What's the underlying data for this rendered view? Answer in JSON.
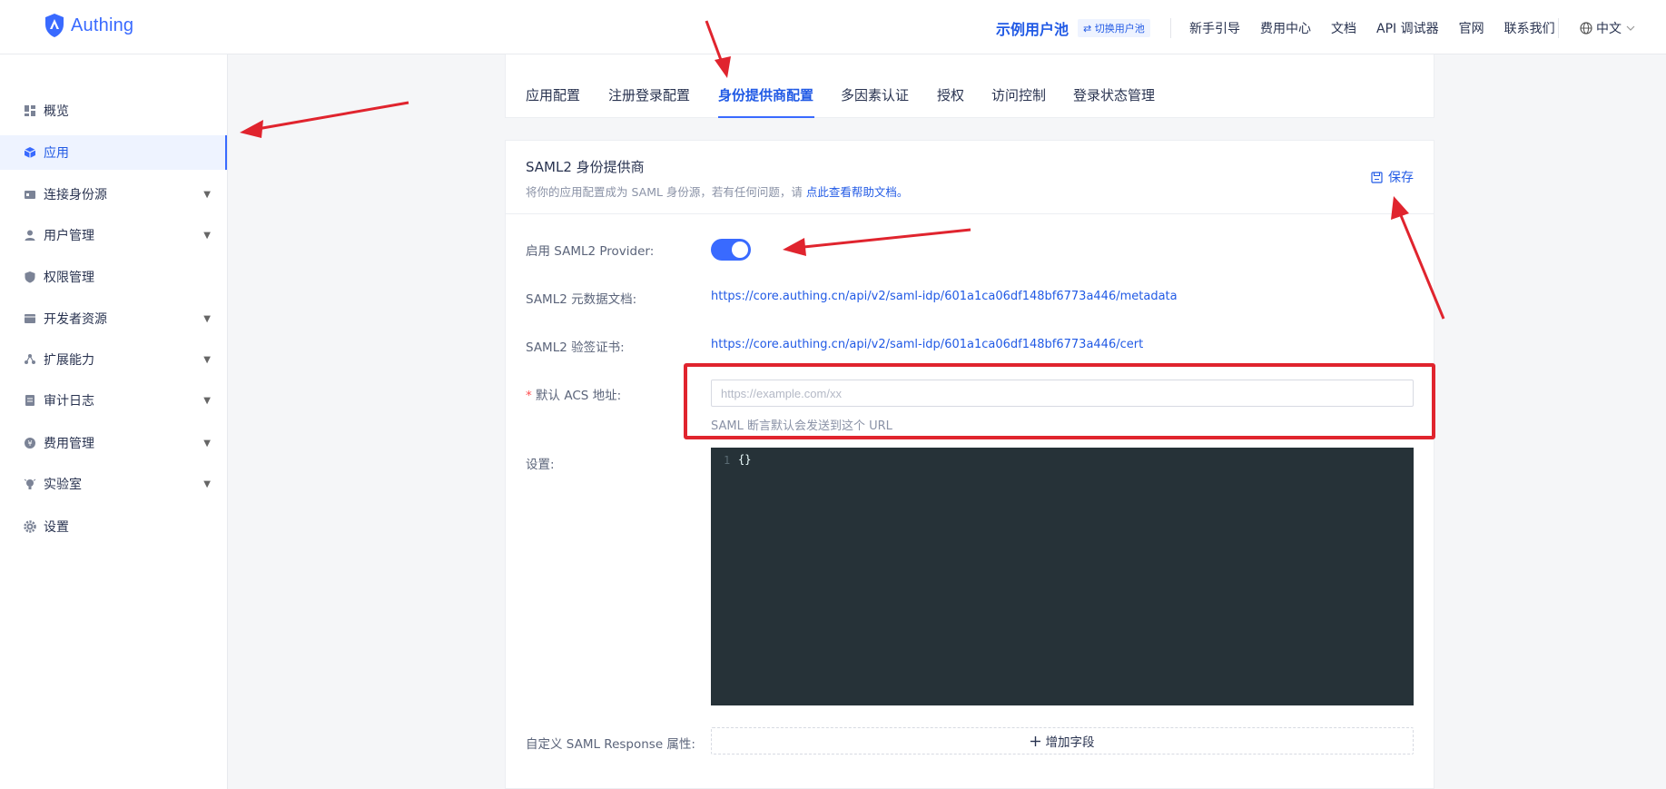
{
  "brand": {
    "logo_text": "Authing"
  },
  "header": {
    "pool_name": "示例用户池",
    "switch_pool": "⇄ 切换用户池",
    "links": [
      "新手引导",
      "费用中心",
      "文档",
      "API 调试器",
      "官网",
      "联系我们"
    ],
    "language": "中文"
  },
  "sidebar": {
    "items": [
      {
        "label": "概览",
        "icon": "dashboard-icon",
        "expandable": false,
        "active": false
      },
      {
        "label": "应用",
        "icon": "cube-icon",
        "expandable": false,
        "active": true
      },
      {
        "label": "连接身份源",
        "icon": "id-card-icon",
        "expandable": true,
        "active": false
      },
      {
        "label": "用户管理",
        "icon": "user-icon",
        "expandable": true,
        "active": false
      },
      {
        "label": "权限管理",
        "icon": "shield-icon",
        "expandable": false,
        "active": false
      },
      {
        "label": "开发者资源",
        "icon": "folder-icon",
        "expandable": true,
        "active": false
      },
      {
        "label": "扩展能力",
        "icon": "nodes-icon",
        "expandable": true,
        "active": false
      },
      {
        "label": "审计日志",
        "icon": "log-icon",
        "expandable": true,
        "active": false
      },
      {
        "label": "费用管理",
        "icon": "coin-icon",
        "expandable": true,
        "active": false
      },
      {
        "label": "实验室",
        "icon": "bulb-icon",
        "expandable": true,
        "active": false
      },
      {
        "label": "设置",
        "icon": "gear-icon",
        "expandable": false,
        "active": false
      }
    ]
  },
  "tabs": [
    "应用配置",
    "注册登录配置",
    "身份提供商配置",
    "多因素认证",
    "授权",
    "访问控制",
    "登录状态管理"
  ],
  "active_tab": "身份提供商配置",
  "panel": {
    "title": "SAML2 身份提供商",
    "subtitle": "将你的应用配置成为 SAML 身份源，若有任何问题，请 ",
    "subtitle_link": "点此查看帮助文档",
    "subtitle_end": "。",
    "save_label": "保存",
    "fields": {
      "enable_label": "启用 SAML2 Provider:",
      "enabled": true,
      "metadata_label": "SAML2 元数据文档:",
      "metadata_url": "https://core.authing.cn/api/v2/saml-idp/601a1ca06df148bf6773a446/metadata",
      "cert_label": "SAML2 验签证书:",
      "cert_url": "https://core.authing.cn/api/v2/saml-idp/601a1ca06df148bf6773a446/cert",
      "acs_required_mark": "*",
      "acs_label": "默认 ACS 地址:",
      "acs_placeholder": "https://example.com/xx",
      "acs_value": "",
      "acs_hint": "SAML 断言默认会发送到这个 URL",
      "settings_label": "设置:",
      "settings_line_number": "1",
      "settings_code": "{}",
      "custom_label": "自定义 SAML Response 属性:",
      "add_field_label": "增加字段"
    }
  },
  "colors": {
    "accent": "#396aff",
    "link": "#215ae5",
    "annotation": "#e0242e",
    "editor_bg": "#263238"
  }
}
